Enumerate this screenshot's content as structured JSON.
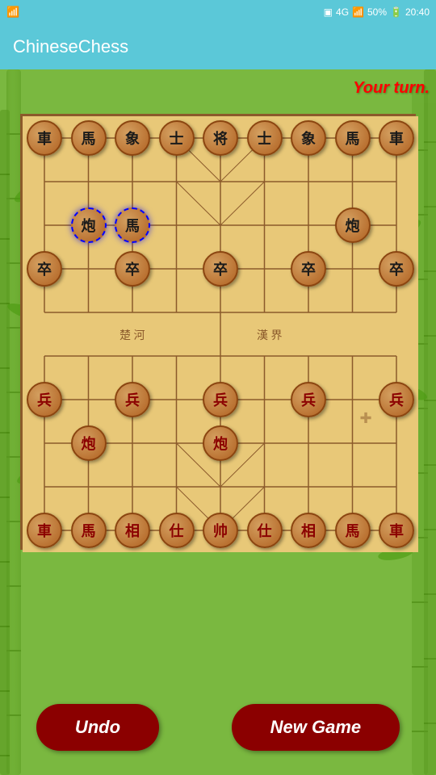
{
  "statusBar": {
    "wifi": "📶",
    "simInfo": "1",
    "network": "4G",
    "signal": "📶",
    "battery": "50%",
    "time": "20:40"
  },
  "appBar": {
    "title": "ChineseChess"
  },
  "game": {
    "yourTurnText": "Your turn.",
    "undoLabel": "Undo",
    "newGameLabel": "New Game"
  },
  "board": {
    "cols": 9,
    "rows": 10,
    "pieces": [
      {
        "id": "b-rook-l",
        "char": "車",
        "team": "black",
        "col": 0,
        "row": 0
      },
      {
        "id": "b-horse-l",
        "char": "馬",
        "team": "black",
        "col": 1,
        "row": 0
      },
      {
        "id": "b-elephant-l",
        "char": "象",
        "team": "black",
        "col": 2,
        "row": 0
      },
      {
        "id": "b-advisor-l",
        "char": "士",
        "team": "black",
        "col": 3,
        "row": 0
      },
      {
        "id": "b-general",
        "char": "将",
        "team": "black",
        "col": 4,
        "row": 0
      },
      {
        "id": "b-advisor-r",
        "char": "士",
        "team": "black",
        "col": 5,
        "row": 0
      },
      {
        "id": "b-elephant-r",
        "char": "象",
        "team": "black",
        "col": 6,
        "row": 0
      },
      {
        "id": "b-horse-r",
        "char": "馬",
        "team": "black",
        "col": 7,
        "row": 0
      },
      {
        "id": "b-rook-r",
        "char": "車",
        "team": "black",
        "col": 8,
        "row": 0
      },
      {
        "id": "b-cannon-l",
        "char": "炮",
        "team": "black",
        "col": 1,
        "row": 2,
        "selected": true
      },
      {
        "id": "b-horse-moved",
        "char": "馬",
        "team": "black",
        "col": 2,
        "row": 2,
        "selected": true
      },
      {
        "id": "b-cannon-r",
        "char": "炮",
        "team": "black",
        "col": 7,
        "row": 2
      },
      {
        "id": "b-pawn-0",
        "char": "卒",
        "team": "black",
        "col": 0,
        "row": 3
      },
      {
        "id": "b-pawn-1",
        "char": "卒",
        "team": "black",
        "col": 2,
        "row": 3
      },
      {
        "id": "b-pawn-2",
        "char": "卒",
        "team": "black",
        "col": 4,
        "row": 3
      },
      {
        "id": "b-pawn-3",
        "char": "卒",
        "team": "black",
        "col": 6,
        "row": 3
      },
      {
        "id": "b-pawn-4",
        "char": "卒",
        "team": "black",
        "col": 8,
        "row": 3
      },
      {
        "id": "r-pawn-0",
        "char": "兵",
        "team": "red",
        "col": 0,
        "row": 6
      },
      {
        "id": "r-pawn-1",
        "char": "兵",
        "team": "red",
        "col": 2,
        "row": 6
      },
      {
        "id": "r-pawn-2",
        "char": "兵",
        "team": "red",
        "col": 4,
        "row": 6
      },
      {
        "id": "r-pawn-3",
        "char": "兵",
        "team": "red",
        "col": 6,
        "row": 6
      },
      {
        "id": "r-pawn-4",
        "char": "兵",
        "team": "red",
        "col": 8,
        "row": 6
      },
      {
        "id": "r-cannon-l",
        "char": "炮",
        "team": "red",
        "col": 1,
        "row": 7
      },
      {
        "id": "r-cannon-r",
        "char": "炮",
        "team": "red",
        "col": 4,
        "row": 7
      },
      {
        "id": "r-rook-l",
        "char": "車",
        "team": "red",
        "col": 0,
        "row": 9
      },
      {
        "id": "r-horse-l",
        "char": "馬",
        "team": "red",
        "col": 1,
        "row": 9
      },
      {
        "id": "r-elephant-l",
        "char": "相",
        "team": "red",
        "col": 2,
        "row": 9
      },
      {
        "id": "r-advisor-l",
        "char": "仕",
        "team": "red",
        "col": 3,
        "row": 9
      },
      {
        "id": "r-general",
        "char": "帅",
        "team": "red",
        "col": 4,
        "row": 9
      },
      {
        "id": "r-advisor-r",
        "char": "仕",
        "team": "red",
        "col": 5,
        "row": 9
      },
      {
        "id": "r-elephant-r",
        "char": "相",
        "team": "red",
        "col": 6,
        "row": 9
      },
      {
        "id": "r-horse-r",
        "char": "馬",
        "team": "red",
        "col": 7,
        "row": 9
      },
      {
        "id": "r-rook-r",
        "char": "車",
        "team": "red",
        "col": 8,
        "row": 9
      }
    ]
  }
}
